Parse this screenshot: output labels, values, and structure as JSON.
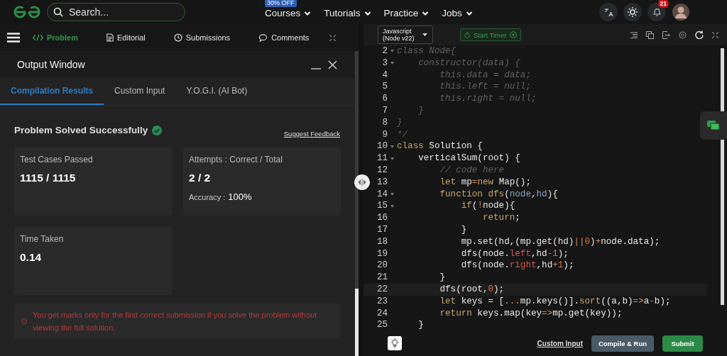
{
  "topnav": {
    "search": {
      "placeholder": "Search..."
    },
    "menu": [
      {
        "label": "Courses",
        "badge": "30% OFF"
      },
      {
        "label": "Tutorials"
      },
      {
        "label": "Practice"
      },
      {
        "label": "Jobs"
      }
    ],
    "notifications": "21"
  },
  "problem_tabs": [
    {
      "label": "Problem",
      "selected": true,
      "kind": "code"
    },
    {
      "label": "Editorial",
      "selected": false,
      "kind": "doc"
    },
    {
      "label": "Submissions",
      "selected": false,
      "kind": "clock"
    },
    {
      "label": "Comments",
      "selected": false,
      "kind": "chat"
    }
  ],
  "output_window": {
    "title": "Output Window",
    "tabs": [
      {
        "label": "Compilation Results",
        "selected": true
      },
      {
        "label": "Custom Input",
        "selected": false
      },
      {
        "label": "Y.O.G.I. (AI Bot)",
        "selected": false
      }
    ],
    "status": "Problem Solved Successfully",
    "feedback_link": "Suggest Feedback",
    "cards": [
      {
        "label": "Test Cases Passed",
        "value": "1115 / 1115"
      },
      {
        "label": "Attempts : Correct / Total",
        "value": "2 / 2",
        "extra_label": "Accuracy :",
        "extra_value": "100%"
      },
      {
        "label": "Time Taken",
        "value": "0.14"
      }
    ],
    "notice": "You get marks only for the first correct submission if you solve the problem without viewing the full solution."
  },
  "editor": {
    "language": "Javascript (Node v22)",
    "timer_button": "Start Timer",
    "lines": [
      {
        "number": "2",
        "foldable": true,
        "current": false,
        "tokens": [
          {
            "kind": "comment",
            "text": "class Node{"
          }
        ]
      },
      {
        "number": "3",
        "foldable": true,
        "current": false,
        "tokens": [
          {
            "kind": "comment",
            "text": "    constructor(data) {"
          }
        ]
      },
      {
        "number": "4",
        "foldable": false,
        "current": false,
        "tokens": [
          {
            "kind": "comment",
            "text": "        this.data = data;"
          }
        ]
      },
      {
        "number": "5",
        "foldable": false,
        "current": false,
        "tokens": [
          {
            "kind": "comment",
            "text": "        this.left = null;"
          }
        ]
      },
      {
        "number": "6",
        "foldable": false,
        "current": false,
        "tokens": [
          {
            "kind": "comment",
            "text": "        this.right = null;"
          }
        ]
      },
      {
        "number": "7",
        "foldable": false,
        "current": false,
        "tokens": [
          {
            "kind": "comment",
            "text": "    }"
          }
        ]
      },
      {
        "number": "8",
        "foldable": false,
        "current": false,
        "tokens": [
          {
            "kind": "comment",
            "text": "}"
          }
        ]
      },
      {
        "number": "9",
        "foldable": false,
        "current": false,
        "tokens": [
          {
            "kind": "comment",
            "text": "*/"
          }
        ]
      },
      {
        "number": "10",
        "foldable": true,
        "current": false,
        "tokens": [
          {
            "kind": "keyword",
            "text": "class"
          },
          {
            "kind": "plain",
            "text": " Solution {"
          }
        ]
      },
      {
        "number": "11",
        "foldable": true,
        "current": false,
        "tokens": [
          {
            "kind": "plain",
            "text": "    verticalSum(root) {"
          }
        ]
      },
      {
        "number": "12",
        "foldable": false,
        "current": false,
        "tokens": [
          {
            "kind": "comment",
            "text": "        // code here"
          }
        ]
      },
      {
        "number": "13",
        "foldable": false,
        "current": false,
        "tokens": [
          {
            "kind": "keyword",
            "text": "        let"
          },
          {
            "kind": "plain",
            "text": " mp"
          },
          {
            "kind": "operator",
            "text": "="
          },
          {
            "kind": "keyword",
            "text": "new"
          },
          {
            "kind": "plain",
            "text": " Map();"
          }
        ]
      },
      {
        "number": "14",
        "foldable": true,
        "current": false,
        "tokens": [
          {
            "kind": "keyword",
            "text": "        function"
          },
          {
            "kind": "function",
            "text": " dfs"
          },
          {
            "kind": "plain",
            "text": "("
          },
          {
            "kind": "param",
            "text": "node"
          },
          {
            "kind": "plain",
            "text": ","
          },
          {
            "kind": "param",
            "text": "hd"
          },
          {
            "kind": "plain",
            "text": "){"
          }
        ]
      },
      {
        "number": "15",
        "foldable": true,
        "current": false,
        "tokens": [
          {
            "kind": "keyword",
            "text": "            if"
          },
          {
            "kind": "plain",
            "text": "("
          },
          {
            "kind": "operator",
            "text": "!"
          },
          {
            "kind": "plain",
            "text": "node){"
          }
        ]
      },
      {
        "number": "16",
        "foldable": false,
        "current": false,
        "tokens": [
          {
            "kind": "keyword",
            "text": "                return"
          },
          {
            "kind": "plain",
            "text": ";"
          }
        ]
      },
      {
        "number": "17",
        "foldable": false,
        "current": false,
        "tokens": [
          {
            "kind": "plain",
            "text": "            }"
          }
        ]
      },
      {
        "number": "18",
        "foldable": false,
        "current": false,
        "tokens": [
          {
            "kind": "plain",
            "text": "            mp.set(hd,(mp.get(hd)"
          },
          {
            "kind": "operator",
            "text": "||"
          },
          {
            "kind": "number",
            "text": "0"
          },
          {
            "kind": "plain",
            "text": ")"
          },
          {
            "kind": "operator",
            "text": "+"
          },
          {
            "kind": "plain",
            "text": "node.data);"
          }
        ]
      },
      {
        "number": "19",
        "foldable": false,
        "current": false,
        "tokens": [
          {
            "kind": "plain",
            "text": "            dfs(node."
          },
          {
            "kind": "property",
            "text": "left"
          },
          {
            "kind": "plain",
            "text": ",hd"
          },
          {
            "kind": "operator",
            "text": "-"
          },
          {
            "kind": "number",
            "text": "1"
          },
          {
            "kind": "plain",
            "text": ");"
          }
        ]
      },
      {
        "number": "20",
        "foldable": false,
        "current": false,
        "tokens": [
          {
            "kind": "plain",
            "text": "            dfs(node."
          },
          {
            "kind": "property",
            "text": "right"
          },
          {
            "kind": "plain",
            "text": ",hd"
          },
          {
            "kind": "operator",
            "text": "+"
          },
          {
            "kind": "number",
            "text": "1"
          },
          {
            "kind": "plain",
            "text": ");"
          }
        ]
      },
      {
        "number": "21",
        "foldable": false,
        "current": false,
        "tokens": [
          {
            "kind": "plain",
            "text": "        }"
          }
        ]
      },
      {
        "number": "22",
        "foldable": false,
        "current": true,
        "tokens": [
          {
            "kind": "plain",
            "text": "        dfs(root,"
          },
          {
            "kind": "number",
            "text": "0"
          },
          {
            "kind": "plain",
            "text": ");"
          }
        ]
      },
      {
        "number": "23",
        "foldable": false,
        "current": false,
        "tokens": [
          {
            "kind": "keyword",
            "text": "        let"
          },
          {
            "kind": "plain",
            "text": " keys = ["
          },
          {
            "kind": "operator",
            "text": "..."
          },
          {
            "kind": "plain",
            "text": "mp.keys()]."
          },
          {
            "kind": "function",
            "text": "sort"
          },
          {
            "kind": "plain",
            "text": "((a,b)"
          },
          {
            "kind": "operator",
            "text": "=>"
          },
          {
            "kind": "plain",
            "text": "a"
          },
          {
            "kind": "operator",
            "text": "-"
          },
          {
            "kind": "plain",
            "text": "b);"
          }
        ]
      },
      {
        "number": "24",
        "foldable": false,
        "current": false,
        "tokens": [
          {
            "kind": "keyword",
            "text": "        return"
          },
          {
            "kind": "plain",
            "text": " keys.map(key"
          },
          {
            "kind": "operator",
            "text": "=>"
          },
          {
            "kind": "plain",
            "text": "mp.get(key));"
          }
        ]
      },
      {
        "number": "25",
        "foldable": false,
        "current": false,
        "tokens": [
          {
            "kind": "plain",
            "text": "    }"
          }
        ]
      }
    ],
    "footer": {
      "custom_input": "Custom Input",
      "compile_button": "Compile & Run",
      "submit_button": "Submit"
    }
  }
}
